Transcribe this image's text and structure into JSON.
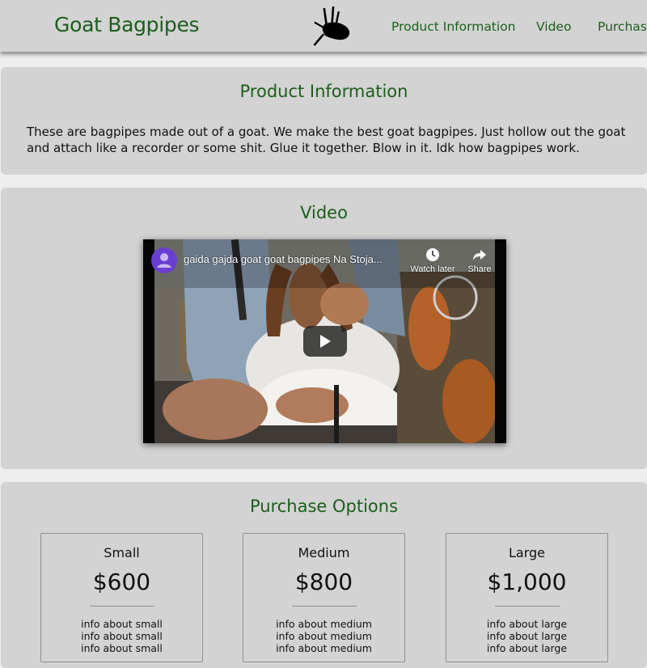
{
  "header": {
    "brand": "Goat Bagpipes",
    "logo_icon": "bagpipes-icon",
    "nav": [
      "Product Information",
      "Video",
      "Purchase"
    ]
  },
  "product": {
    "title": "Product Information",
    "text": "These are bagpipes made out of a goat. We make the best goat bagpipes. Just hollow out the goat and attach like a recorder or some shit. Glue it together. Blow in it. Idk how bagpipes work."
  },
  "video_section": {
    "title": "Video",
    "video_title": "gaida gajda goat goat bagpipes Na Stoja...",
    "watch_later": "Watch later",
    "share": "Share",
    "play_icon": "play-icon"
  },
  "purchase": {
    "title": "Purchase Options",
    "cards": [
      {
        "size": "Small",
        "price": "$600",
        "info": [
          "info about small",
          "info about small",
          "info about small"
        ]
      },
      {
        "size": "Medium",
        "price": "$800",
        "info": [
          "info about medium",
          "info about medium",
          "info about medium"
        ]
      },
      {
        "size": "Large",
        "price": "$1,000",
        "info": [
          "info about large",
          "info about large",
          "info about large"
        ]
      }
    ]
  },
  "colors": {
    "accent_green": "#1c5e1c",
    "panel_gray": "#d3d3d3",
    "page_bg": "#eeeeee"
  }
}
